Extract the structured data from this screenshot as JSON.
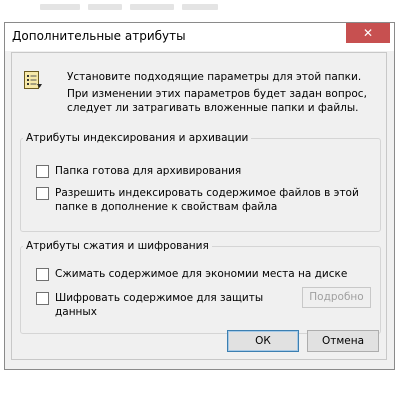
{
  "dialog": {
    "title": "Дополнительные атрибуты",
    "close_glyph": "✕"
  },
  "info": {
    "icon": "folder-properties-icon",
    "line1": "Установите подходящие параметры для этой папки.",
    "line2": "При изменении этих параметров будет задан вопрос, следует ли затрагивать вложенные папки и файлы."
  },
  "indexing_group": {
    "legend": "Атрибуты индексирования и архивации",
    "archive_label": "Папка готова для архивирования",
    "archive_checked": false,
    "index_label": "Разрешить индексировать содержимое файлов в этой папке в дополнение к свойствам файла",
    "index_checked": false
  },
  "compression_group": {
    "legend": "Атрибуты сжатия и шифрования",
    "compress_label": "Сжимать содержимое для экономии места на диске",
    "compress_checked": false,
    "encrypt_label": "Шифровать содержимое для защиты данных",
    "encrypt_checked": false,
    "details_label": "Подробно"
  },
  "buttons": {
    "ok_label": "ОК",
    "cancel_label": "Отмена"
  },
  "colors": {
    "close_button": "#c75050",
    "dialog_bg": "#f0f0f0",
    "default_button_border": "#3c7fb1"
  }
}
